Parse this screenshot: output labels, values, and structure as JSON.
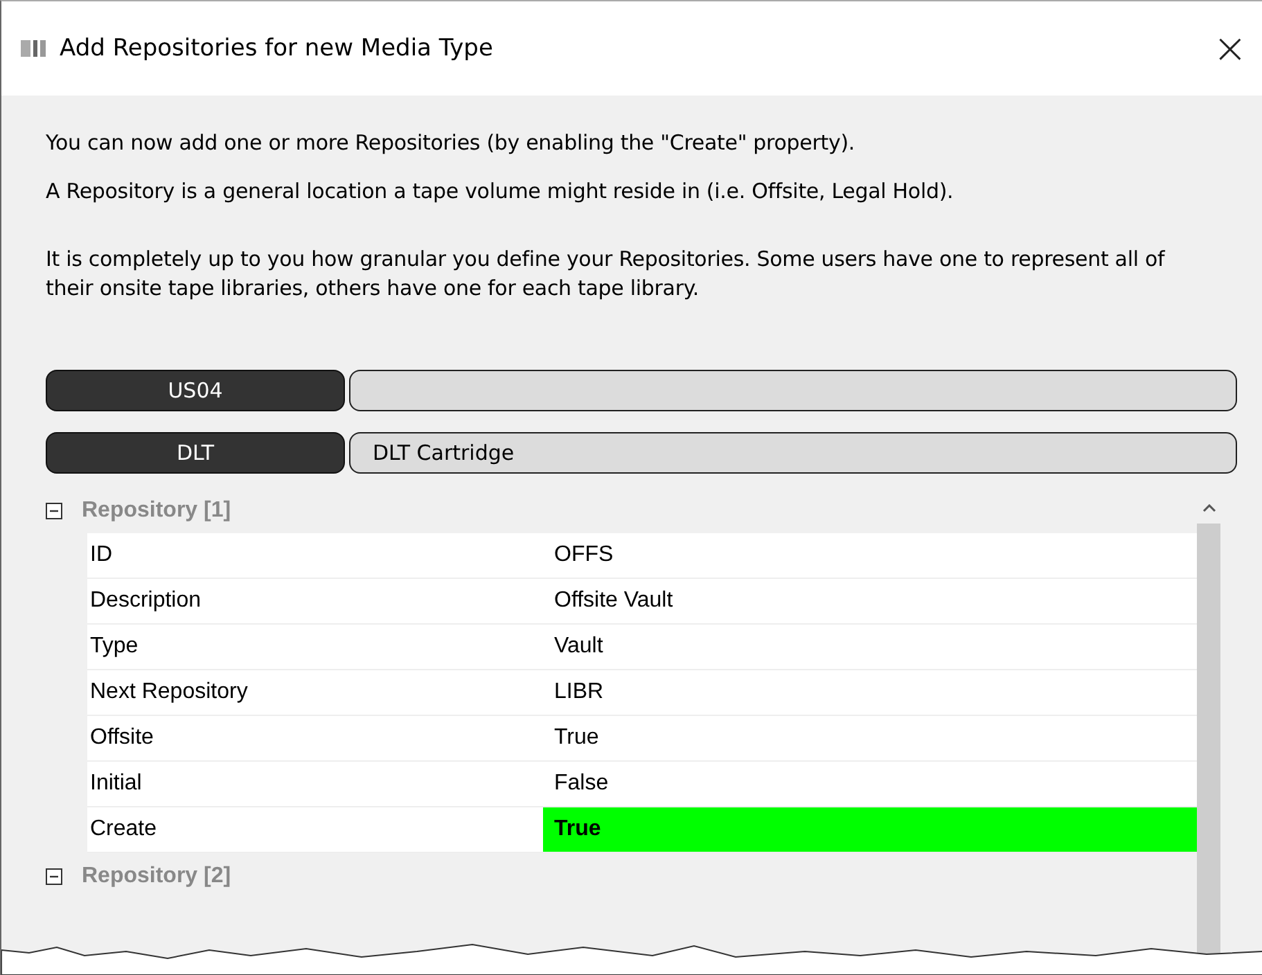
{
  "window": {
    "title": "Add Repositories for new Media Type",
    "close": "×"
  },
  "paragraphs": [
    "You can now add one or more Repositories (by enabling the \"Create\" property).",
    "A Repository is a general location a tape volume might reside in (i.e. Offsite, Legal Hold).",
    "It is completely up to you how granular you define your Repositories. Some users have one to represent all of their onsite tape libraries, others have one for each tape library."
  ],
  "records": [
    {
      "code": "US04"
    },
    {
      "code": "DLT",
      "description": "DLT Cartridge"
    }
  ],
  "groups": [
    {
      "title": "Repository [1]",
      "expanded": true,
      "rows": [
        {
          "name": "ID",
          "value": "OFFS",
          "highlighted": false
        },
        {
          "name": "Description",
          "value": "Offsite Vault",
          "highlighted": false
        },
        {
          "name": "Type",
          "value": "Vault",
          "highlighted": false
        },
        {
          "name": "Next Repository",
          "value": "LIBR",
          "highlighted": false
        },
        {
          "name": "Offsite",
          "value": "True",
          "highlighted": false
        },
        {
          "name": "Initial",
          "value": "False",
          "highlighted": false
        },
        {
          "name": "Create",
          "value": "True",
          "highlighted": true
        }
      ]
    },
    {
      "title": "Repository [2]",
      "expanded": true
    }
  ]
}
